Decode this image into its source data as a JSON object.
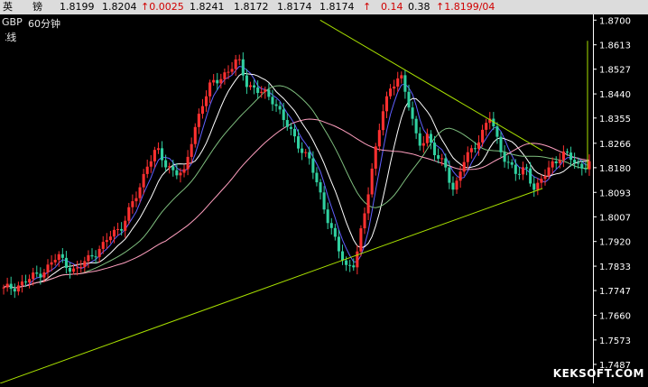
{
  "quote_bar": {
    "name_char1": "英",
    "name_char2": "镑",
    "open": "1.8199",
    "prev": "1.8204",
    "change": "↑0.0025",
    "high": "1.8241",
    "low": "1.8172",
    "close": "1.8174",
    "last": "1.8174",
    "arrow": "↑",
    "v1": "0.14",
    "v2": "0.38",
    "last_time": "↑1.8199/04"
  },
  "symbol": "GBP",
  "period": "60分钟",
  "chart_type_label": "K线",
  "watermark": "KEKSOFT.COM",
  "colors": {
    "background": "#000000",
    "axis": "#ffffff",
    "trendline": "#a8e000",
    "ma_short": "#ffffff",
    "ma_mid": "#6060ff",
    "ma_long": "#7fbf7f",
    "ma_longest": "#ff9fbf",
    "candle_up": "#ff3030",
    "candle_down": "#30d0a0"
  },
  "chart_data": {
    "type": "line",
    "y_ticks": [
      "1.8700",
      "1.8613",
      "1.8527",
      "1.8440",
      "1.8355",
      "1.8266",
      "1.8180",
      "1.8093",
      "1.8007",
      "1.7920",
      "1.7833",
      "1.7747",
      "1.7660",
      "1.7573",
      "1.7487"
    ],
    "ylim": [
      1.742,
      1.872
    ],
    "close_series": [
      1.775,
      1.776,
      1.777,
      1.779,
      1.781,
      1.783,
      1.787,
      1.784,
      1.781,
      1.785,
      1.788,
      1.79,
      1.795,
      1.797,
      1.803,
      1.81,
      1.82,
      1.824,
      1.819,
      1.817,
      1.815,
      1.83,
      1.84,
      1.847,
      1.85,
      1.852,
      1.856,
      1.848,
      1.845,
      1.844,
      1.842,
      1.835,
      1.83,
      1.825,
      1.82,
      1.81,
      1.8,
      1.79,
      1.783,
      1.785,
      1.8,
      1.82,
      1.838,
      1.845,
      1.852,
      1.84,
      1.825,
      1.83,
      1.822,
      1.818,
      1.81,
      1.82,
      1.824,
      1.83,
      1.836,
      1.825,
      1.82,
      1.815,
      1.818,
      1.81,
      1.815,
      1.82,
      1.823,
      1.821,
      1.818,
      1.82
    ],
    "trendlines": [
      {
        "name": "upper",
        "from": [
          0.54,
          1.87
        ],
        "to": [
          0.915,
          1.824
        ]
      },
      {
        "name": "lower",
        "from": [
          0.0,
          1.742
        ],
        "to": [
          0.915,
          1.8107
        ]
      }
    ]
  }
}
